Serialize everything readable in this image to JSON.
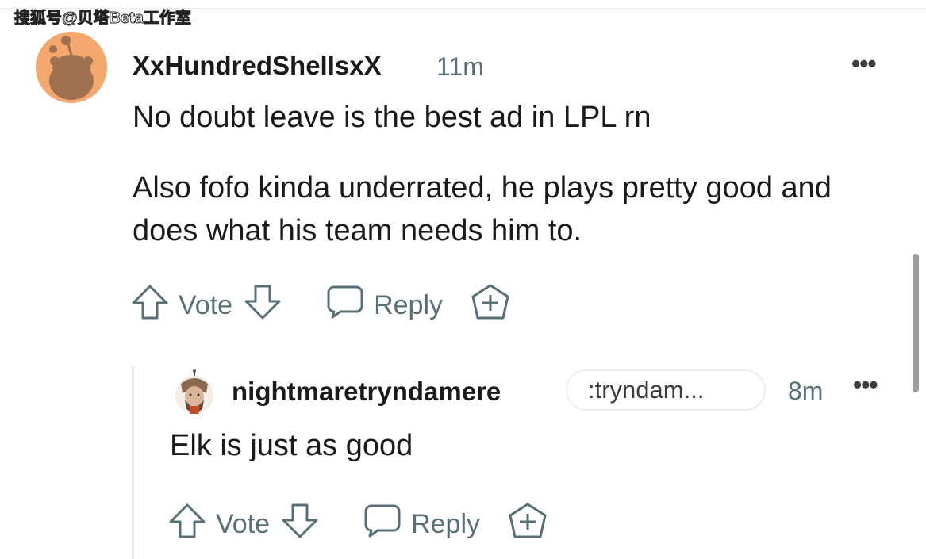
{
  "watermark": "搜狐号@贝塔Beta工作室",
  "colors": {
    "avatar_bg": "#f5a86e",
    "meta_text": "#576f76",
    "body_text": "#1a1a1b",
    "thread_line": "#e6e6e6"
  },
  "comment": {
    "username": "XxHundredShellsxX",
    "time": "11m",
    "more": "•••",
    "paragraphs": [
      "No doubt leave is the best ad in LPL rn",
      "Also fofo kinda underrated, he plays pretty good and does what his team needs him to."
    ],
    "actions": {
      "upvote_icon": "arrow-up-icon",
      "vote_label": "Vote",
      "downvote_icon": "arrow-down-icon",
      "reply_icon": "speech-bubble-icon",
      "reply_label": "Reply",
      "award_icon": "plus-award-icon"
    }
  },
  "reply": {
    "username": "nightmaretryndamere",
    "flair": ":tryndam...",
    "time": "8m",
    "more": "•••",
    "body": "Elk is just as good",
    "actions": {
      "vote_label": "Vote",
      "reply_label": "Reply"
    }
  }
}
